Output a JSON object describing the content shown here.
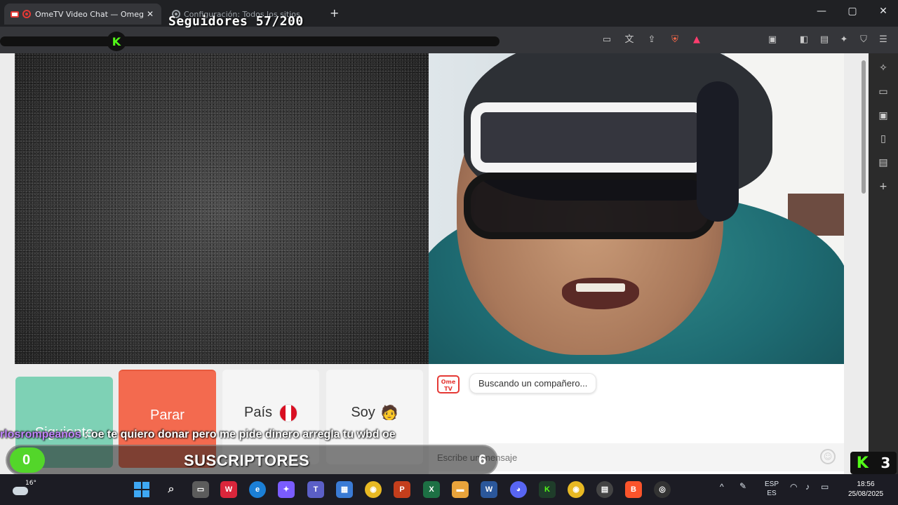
{
  "browser": {
    "tabs": [
      {
        "title": "OmeTV Video Chat — Omeg",
        "active": true
      },
      {
        "title": "Configuración: Todos los sitios",
        "active": false
      }
    ],
    "new_tab_label": "+",
    "window_controls": {
      "minimize": "—",
      "maximize": "▢",
      "close": "✕"
    }
  },
  "stream_overlay": {
    "followers_text": "Seguidores 57/200",
    "followers_progress": 0.285,
    "chat_user": "rlosrompeanos",
    "chat_separator": " : ",
    "chat_message": "oe te quiero donar pero me pide dinero arregla tu wbd oe",
    "subs_current": "0",
    "subs_label": "SUSCRIPTORES",
    "subs_goal": "6",
    "kick_viewers": "3"
  },
  "controls": {
    "next_label": "Siguiente",
    "stop_label": "Parar",
    "country_label": "País",
    "soy_label": "Soy",
    "soy_emoji": "🧑"
  },
  "chat": {
    "logo_text": "Ome TV",
    "status_message": "Buscando un compañero...",
    "input_placeholder": "Escribe un mensaje"
  },
  "taskbar": {
    "weather_temp": "16°",
    "language_top": "ESP",
    "language_bottom": "ES",
    "time": "18:56",
    "date": "25/08/2025"
  },
  "colors": {
    "next": "#7ed1b5",
    "stop": "#f36a4f",
    "kick_green": "#53fc18",
    "subs_fill": "#53d62a"
  }
}
